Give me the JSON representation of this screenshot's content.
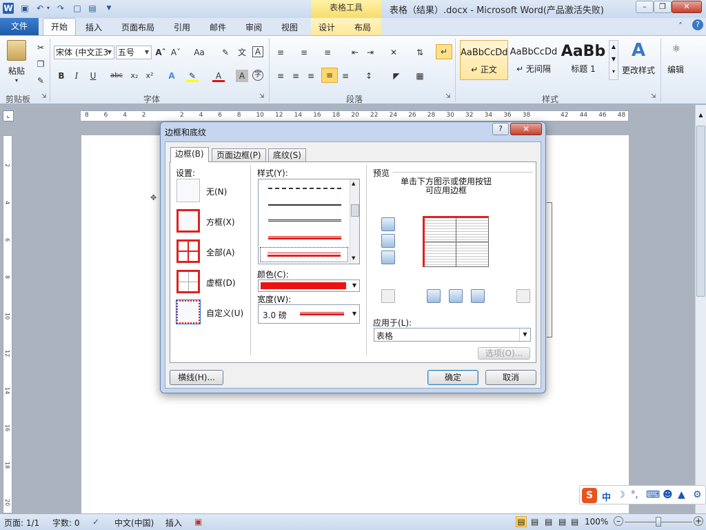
{
  "window": {
    "title": "表格（结果）.docx  -  Microsoft Word(产品激活失败)",
    "context_tab_group": "表格工具"
  },
  "ribbon_tabs": [
    "文件",
    "开始",
    "插入",
    "页面布局",
    "引用",
    "邮件",
    "审阅",
    "视图",
    "设计",
    "布局"
  ],
  "ribbon": {
    "clipboard": {
      "paste": "粘贴",
      "group": "剪贴板"
    },
    "font": {
      "font_name": "宋体 (中文正3",
      "font_size": "五号",
      "group": "字体",
      "change_case": "Aa"
    },
    "paragraph": {
      "group": "段落"
    },
    "styles": {
      "group": "样式",
      "items": [
        {
          "preview": "AaBbCcDd",
          "name": "↵ 正文"
        },
        {
          "preview": "AaBbCcDd",
          "name": "↵ 无间隔"
        },
        {
          "preview": "AaBb",
          "name": "标题 1"
        }
      ],
      "change_styles": "更改样式"
    },
    "editing": {
      "label": "编辑"
    }
  },
  "ruler_numbers": [
    "8",
    "6",
    "4",
    "2",
    "",
    "2",
    "4",
    "6",
    "8",
    "10",
    "12",
    "14",
    "16",
    "18",
    "20",
    "22",
    "24",
    "26",
    "28",
    "30",
    "32",
    "34",
    "36",
    "38",
    "",
    "42",
    "44",
    "46",
    "48"
  ],
  "vruler_numbers": [
    "2",
    "4",
    "6",
    "8",
    "10",
    "12",
    "14",
    "16",
    "18",
    "20"
  ],
  "dialog": {
    "title": "边框和底纹",
    "help": "?",
    "close": "✕",
    "tabs": [
      "边框(B)",
      "页面边框(P)",
      "底纹(S)"
    ],
    "settings_label": "设置:",
    "settings": [
      "无(N)",
      "方框(X)",
      "全部(A)",
      "虚框(D)",
      "自定义(U)"
    ],
    "style_label": "样式(Y):",
    "color_label": "颜色(C):",
    "color_value": "#ee1111",
    "width_label": "宽度(W):",
    "width_value": "3.0 磅",
    "preview_label": "预览",
    "preview_hint": "单击下方图示或使用按钮可应用边框",
    "apply_label": "应用于(L):",
    "apply_value": "表格",
    "options_btn": "选项(O)...",
    "horizontal_line_btn": "横线(H)...",
    "ok": "确定",
    "cancel": "取消"
  },
  "statusbar": {
    "page": "页面: 1/1",
    "words": "字数: 0",
    "language": "中文(中国)",
    "mode": "插入",
    "zoom": "100%"
  },
  "ime": {
    "brand": "S",
    "mode": "中"
  }
}
